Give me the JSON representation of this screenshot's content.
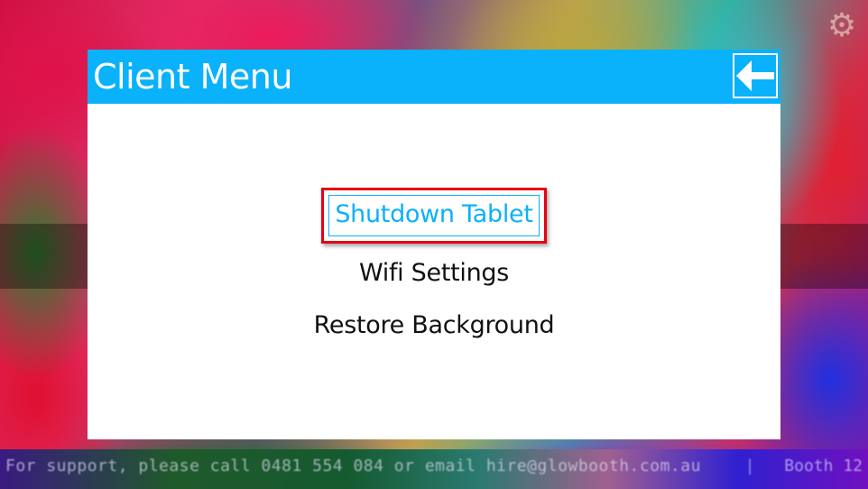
{
  "dialog": {
    "title": "Client Menu",
    "back_button": {
      "icon": "arrow-left-icon",
      "label": "Back"
    }
  },
  "menu": {
    "items": [
      {
        "label": "Shutdown Tablet",
        "selected": true
      },
      {
        "label": "Wifi Settings",
        "selected": false
      },
      {
        "label": "Restore Background",
        "selected": false
      }
    ]
  },
  "settings_icon": "gear-icon",
  "footer": {
    "support_text": "For support, please call 0481 554 084 or email hire@glowbooth.com.au",
    "separator": "|",
    "booth_label": "Booth 12"
  },
  "colors": {
    "accent": "#0ab1fb",
    "selection_border": "#e60012",
    "dialog_background": "#ffffff"
  }
}
